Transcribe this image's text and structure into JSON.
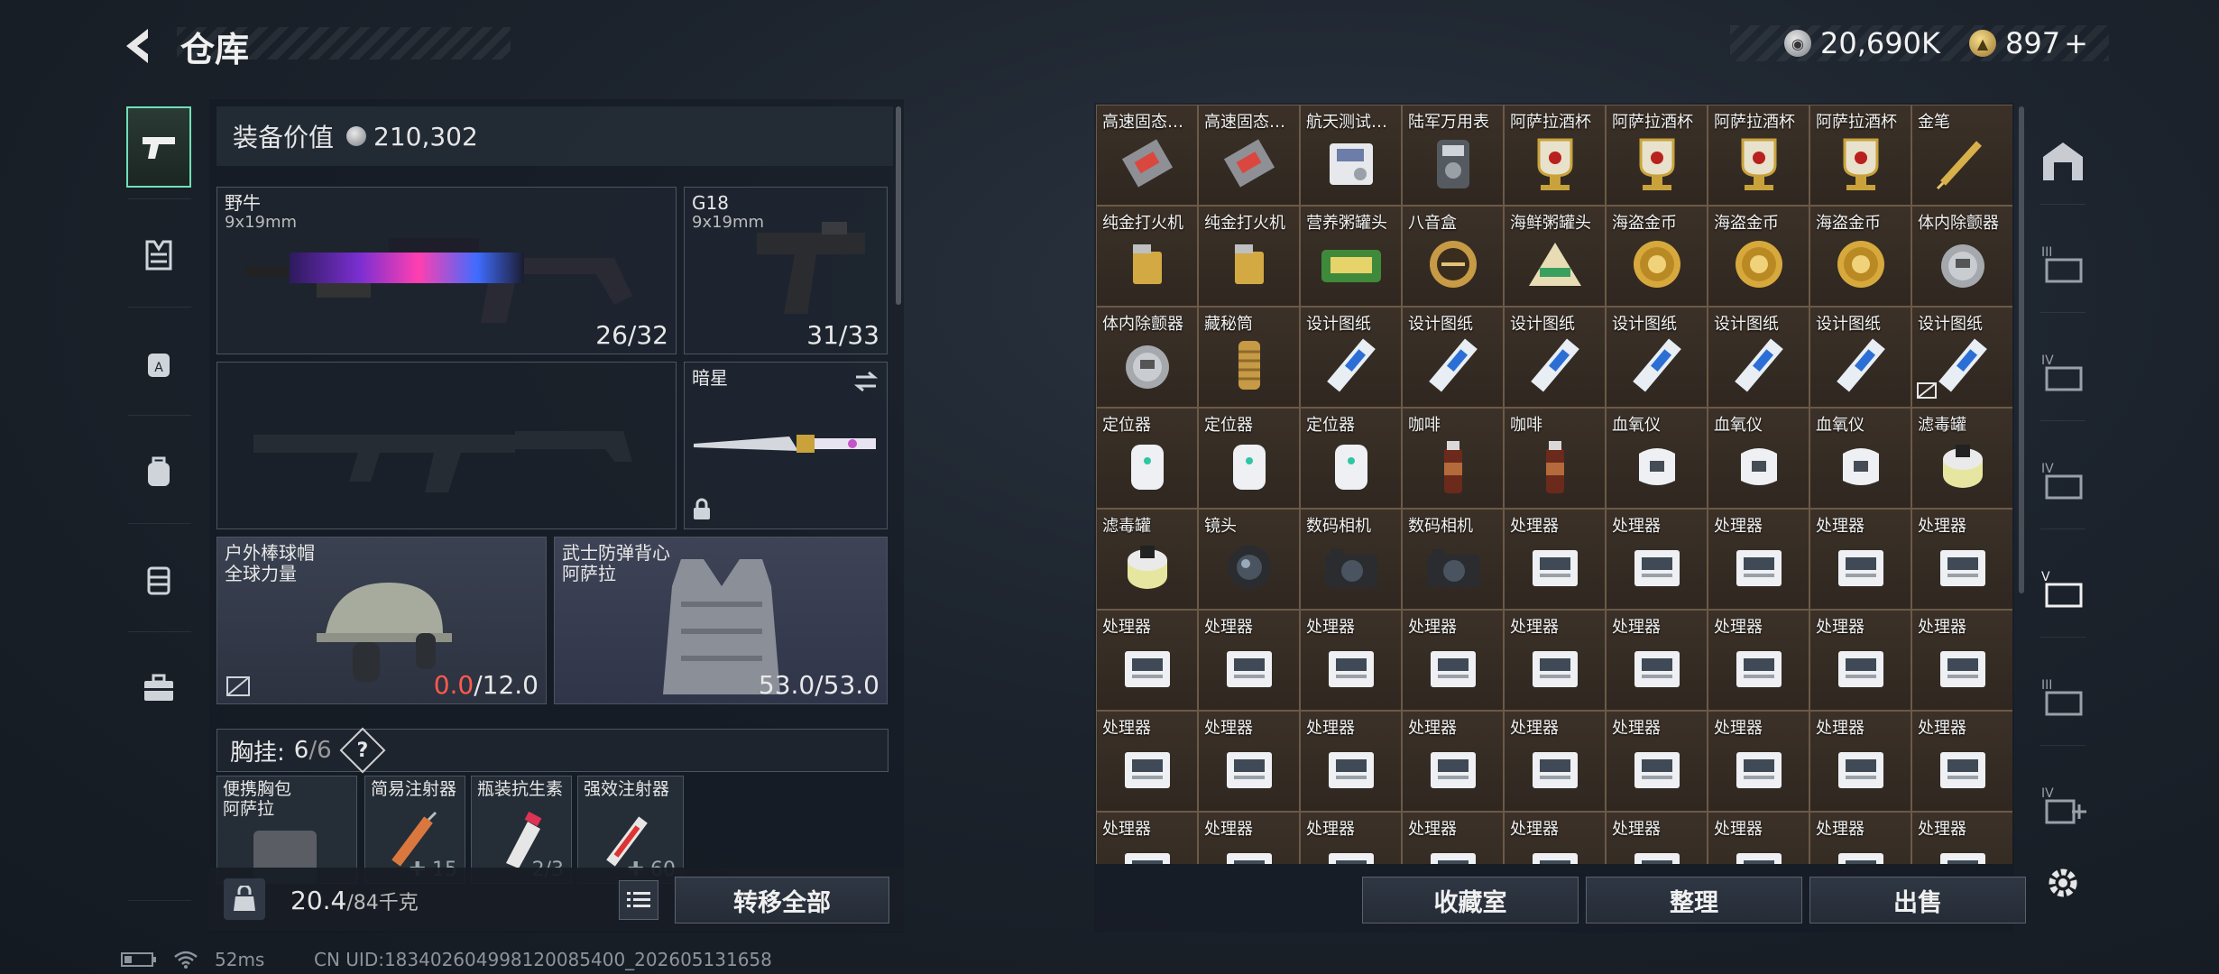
{
  "header": {
    "title": "仓库",
    "currency_silver": "20,690K",
    "currency_gold": "897",
    "currency_plus": "+"
  },
  "equipment": {
    "value_label": "装备价值",
    "value": "210,302",
    "primary_weapon": {
      "name": "野牛",
      "caliber": "9x19mm",
      "ammo": "26/32"
    },
    "secondary_weapon": {
      "name": "G18",
      "caliber": "9x19mm",
      "ammo": "31/33"
    },
    "melee": {
      "name": "暗星"
    },
    "helmet": {
      "name": "户外棒球帽",
      "sub": "全球力量",
      "dur_current": "0.0",
      "dur_max": "/12.0"
    },
    "vest": {
      "name": "武士防弹背心",
      "sub": "阿萨拉",
      "dur": "53.0/53.0"
    },
    "chest_rig": {
      "label": "胸挂:",
      "count": "6",
      "sep": "/",
      "total": "6",
      "help": "?"
    },
    "rig_items": [
      {
        "name": "便携胸包",
        "sub": "阿萨拉",
        "count": ""
      },
      {
        "name": "简易注射器",
        "count": "15"
      },
      {
        "name": "瓶装抗生素",
        "count": "2/3"
      },
      {
        "name": "强效注射器",
        "count": "60"
      }
    ],
    "weight_current": "20.4",
    "weight_max": "/84千克",
    "transfer_all": "转移全部"
  },
  "storage": {
    "items": [
      "高速固态…",
      "高速固态…",
      "航天测试…",
      "陆军万用表",
      "阿萨拉酒杯",
      "阿萨拉酒杯",
      "阿萨拉酒杯",
      "阿萨拉酒杯",
      "金笔",
      "纯金打火机",
      "纯金打火机",
      "营养粥罐头",
      "八音盒",
      "海鲜粥罐头",
      "海盗金币",
      "海盗金币",
      "海盗金币",
      "体内除颤器",
      "体内除颤器",
      "藏秘筒",
      "设计图纸",
      "设计图纸",
      "设计图纸",
      "设计图纸",
      "设计图纸",
      "设计图纸",
      "设计图纸",
      "定位器",
      "定位器",
      "定位器",
      "咖啡",
      "咖啡",
      "血氧仪",
      "血氧仪",
      "血氧仪",
      "滤毒罐",
      "滤毒罐",
      "镜头",
      "数码相机",
      "数码相机",
      "处理器",
      "处理器",
      "处理器",
      "处理器",
      "处理器",
      "处理器",
      "处理器",
      "处理器",
      "处理器",
      "处理器",
      "处理器",
      "处理器",
      "处理器",
      "处理器",
      "处理器",
      "处理器",
      "处理器",
      "处理器",
      "处理器",
      "处理器",
      "处理器",
      "处理器",
      "处理器",
      "处理器",
      "处理器",
      "处理器",
      "处理器",
      "处理器",
      "处理器",
      "处理器",
      "处理器",
      "处理器"
    ],
    "item_kinds": [
      "ssd",
      "ssd",
      "tester",
      "multimeter",
      "goblet",
      "goblet",
      "goblet",
      "goblet",
      "pen",
      "lighter",
      "lighter",
      "can",
      "musicbox",
      "pyramid",
      "coin",
      "coin",
      "coin",
      "defib",
      "defib",
      "cylinder",
      "blueprint",
      "blueprint",
      "blueprint",
      "blueprint",
      "blueprint",
      "blueprint",
      "blueprint",
      "locator",
      "locator",
      "locator",
      "coffee",
      "coffee",
      "oximeter",
      "oximeter",
      "oximeter",
      "filter",
      "filter",
      "lens",
      "camera",
      "camera",
      "processor",
      "processor",
      "processor",
      "processor",
      "processor",
      "processor",
      "processor",
      "processor",
      "processor",
      "processor",
      "processor",
      "processor",
      "processor",
      "processor",
      "processor",
      "processor",
      "processor",
      "processor",
      "processor",
      "processor",
      "processor",
      "processor",
      "processor",
      "processor",
      "processor",
      "processor",
      "processor",
      "processor",
      "processor",
      "processor",
      "processor",
      "processor"
    ],
    "buttons": {
      "collection": "收藏室",
      "sort": "整理",
      "sell": "出售"
    }
  },
  "status": {
    "ping": "52ms",
    "uid": "CN UID:18340260499812008540​0_202605131658"
  },
  "colors": {
    "accent_green": "#6fe0b6",
    "durability_red": "#ff5a4e",
    "grid_bg": "#3b3128"
  }
}
